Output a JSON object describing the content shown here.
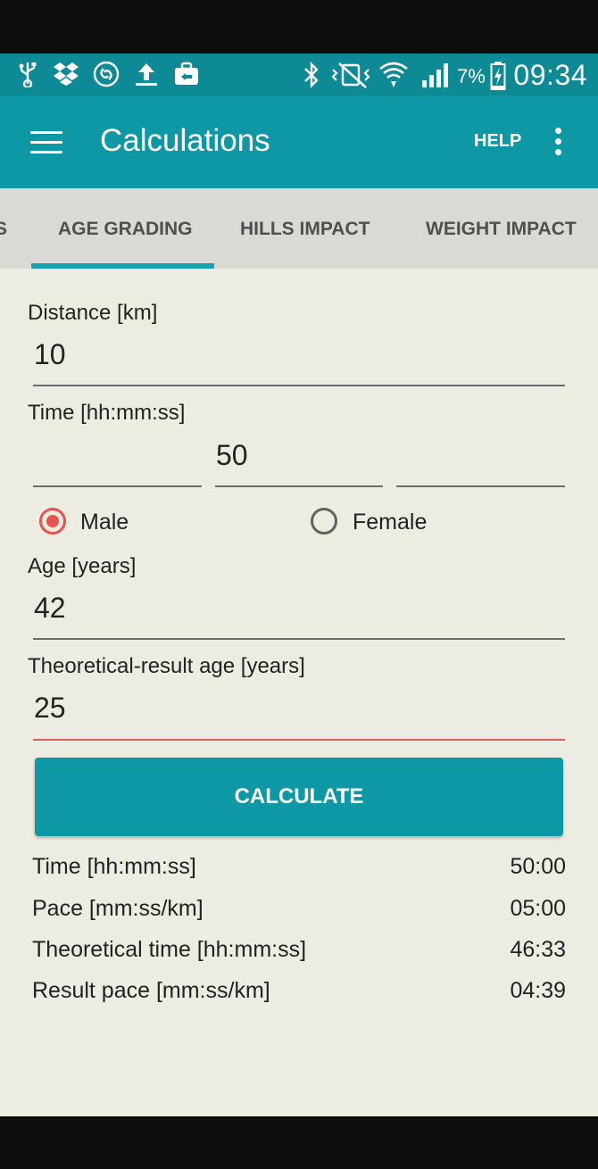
{
  "status": {
    "battery_percent": "7%",
    "time": "09:34",
    "icons": [
      "usb-icon",
      "dropbox-icon",
      "shazam-icon",
      "upload-icon",
      "briefcase-icon",
      "bluetooth-icon",
      "vibrate-icon",
      "wifi-icon",
      "signal-icon",
      "battery-charging-icon"
    ]
  },
  "appbar": {
    "title": "Calculations",
    "help_label": "HELP"
  },
  "tabs": [
    {
      "label": "S"
    },
    {
      "label": "AGE GRADING",
      "selected": true
    },
    {
      "label": "HILLS IMPACT"
    },
    {
      "label": "WEIGHT IMPACT"
    }
  ],
  "form": {
    "distance_label": "Distance [km]",
    "distance_value": "10",
    "time_label": "Time [hh:mm:ss]",
    "time_hours": "",
    "time_minutes": "50",
    "time_seconds": "",
    "gender_male": "Male",
    "gender_female": "Female",
    "gender_selected": "Male",
    "age_label": "Age [years]",
    "age_value": "42",
    "theoretical_age_label": "Theoretical-result age [years]",
    "theoretical_age_value": "25",
    "calculate_label": "CALCULATE"
  },
  "results": [
    {
      "label": "Time [hh:mm:ss]",
      "value": "50:00"
    },
    {
      "label": "Pace [mm:ss/km]",
      "value": "05:00"
    },
    {
      "label": "Theoretical time [hh:mm:ss]",
      "value": "46:33"
    },
    {
      "label": "Result pace [mm:ss/km]",
      "value": "04:39"
    }
  ],
  "colors": {
    "primary": "#0e98a6",
    "status_bar": "#0d8a96",
    "accent": "#e8534f",
    "background": "#ecece2",
    "tab_bar": "#d9d9d5"
  }
}
